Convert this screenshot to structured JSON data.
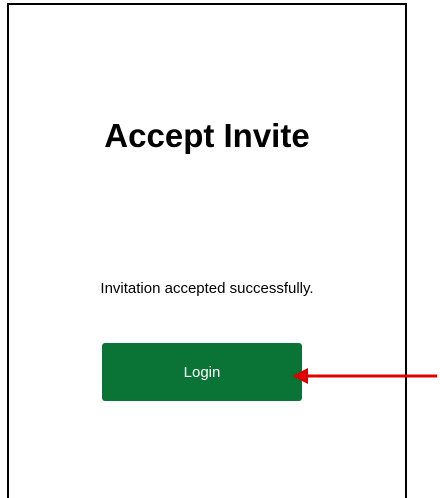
{
  "page": {
    "title": "Accept Invite",
    "message": "Invitation accepted successfully.",
    "login_label": "Login"
  },
  "colors": {
    "button_bg": "#0a7437",
    "button_text": "#ffffff",
    "annotation_arrow": "#e00000"
  },
  "icons": {
    "annotation": "arrow-left-icon"
  }
}
